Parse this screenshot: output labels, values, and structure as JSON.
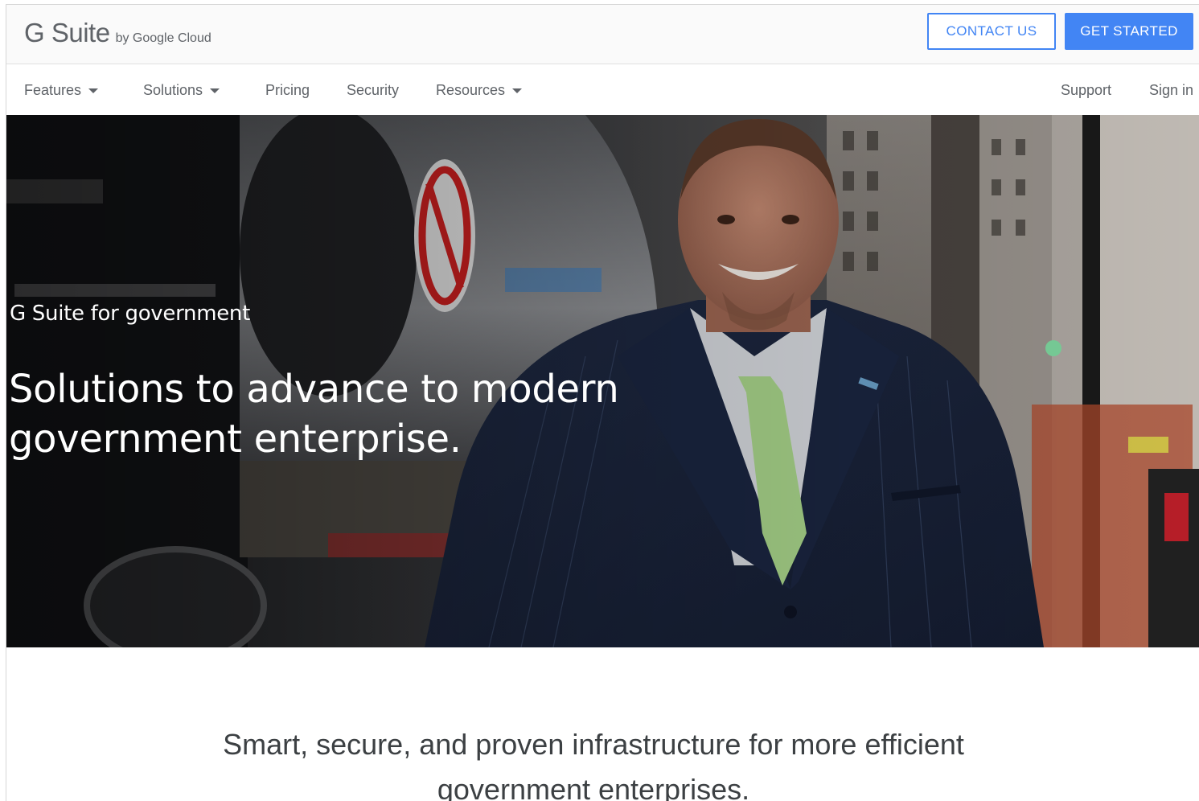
{
  "header": {
    "logo_main": "G Suite",
    "logo_sub": "by Google Cloud",
    "contact_label": "CONTACT US",
    "get_started_label": "GET STARTED"
  },
  "nav": {
    "features": "Features",
    "solutions": "Solutions",
    "pricing": "Pricing",
    "security": "Security",
    "resources": "Resources",
    "support": "Support",
    "sign_in": "Sign in"
  },
  "hero": {
    "eyebrow": "G Suite for government",
    "title": "Solutions to advance to modern government enterprise."
  },
  "content": {
    "lead": "Smart, secure, and proven infrastructure for more efficient government enterprises."
  },
  "colors": {
    "brand_blue": "#4285f4",
    "nav_text": "#5f6368",
    "body_text": "#3c4043"
  },
  "icons": {
    "dropdown": "caret-down-icon"
  }
}
